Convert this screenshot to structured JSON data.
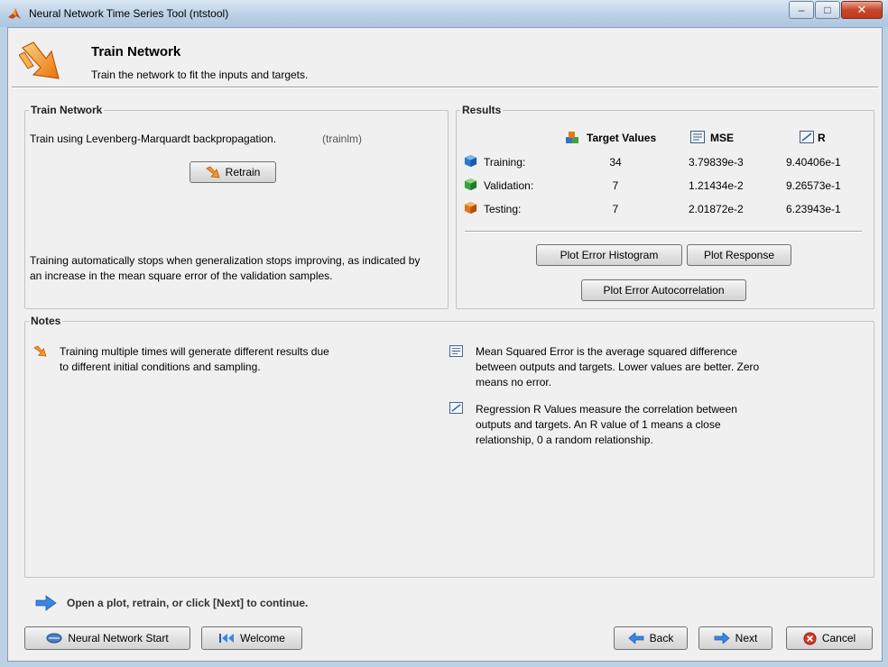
{
  "window": {
    "title": "Neural Network Time Series Tool (ntstool)"
  },
  "header": {
    "title": "Train Network",
    "subtitle": "Train the network to fit the inputs and targets."
  },
  "train_panel": {
    "legend": "Train Network",
    "algorithm_text": "Train using Levenberg-Marquardt backpropagation.",
    "algorithm_code": "(trainlm)",
    "retrain_label": "Retrain",
    "stop_note": "Training automatically stops when generalization stops improving, as indicated by an increase in the mean square error of the validation samples."
  },
  "results": {
    "legend": "Results",
    "columns": {
      "targets": "Target Values",
      "mse": "MSE",
      "r": "R"
    },
    "rows": [
      {
        "label": "Training:",
        "targets": "34",
        "mse": "3.79839e-3",
        "r": "9.40406e-1"
      },
      {
        "label": "Validation:",
        "targets": "7",
        "mse": "1.21434e-2",
        "r": "9.26573e-1"
      },
      {
        "label": "Testing:",
        "targets": "7",
        "mse": "2.01872e-2",
        "r": "6.23943e-1"
      }
    ],
    "buttons": {
      "histogram": "Plot Error Histogram",
      "response": "Plot Response",
      "autocorr": "Plot Error Autocorrelation"
    }
  },
  "notes": {
    "legend": "Notes",
    "note1_line1": "Training multiple times will generate different results due",
    "note1_line2": "to different initial conditions and sampling.",
    "mse_line1": "Mean Squared Error is the average squared difference",
    "mse_line2": "between outputs and targets. Lower values are better. Zero",
    "mse_line3": "means no error.",
    "r_line1": "Regression R Values measure the correlation between",
    "r_line2": "outputs and targets. An R value of 1 means a close",
    "r_line3": "relationship, 0 a random relationship."
  },
  "footer": {
    "hint": "Open a plot, retrain, or click [Next] to continue.",
    "nn_start": "Neural Network Start",
    "welcome": "Welcome",
    "back": "Back",
    "next": "Next",
    "cancel": "Cancel"
  }
}
